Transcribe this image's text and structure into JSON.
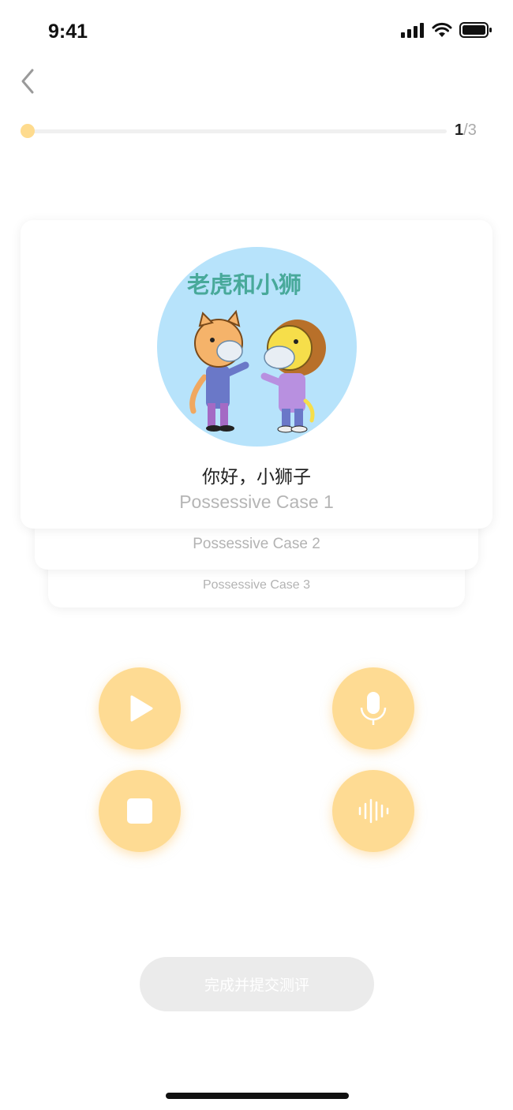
{
  "status_bar": {
    "time": "9:41"
  },
  "progress": {
    "current": "1",
    "separator": "/",
    "total": "3",
    "fraction": 0.0
  },
  "cards": [
    {
      "title": "你好，小狮子",
      "subtitle": "Possessive Case 1",
      "image_caption": "老虎和小狮"
    },
    {
      "subtitle": "Possessive Case 2"
    },
    {
      "subtitle": "Possessive Case 3"
    }
  ],
  "controls": {
    "play": "play-icon",
    "record": "microphone-icon",
    "stop": "stop-icon",
    "playback": "waveform-icon"
  },
  "submit_button": {
    "label": "完成并提交测评"
  },
  "colors": {
    "accent": "#fedb8e",
    "control_bg": "#fedb93",
    "disabled_button": "#ebebeb",
    "muted_text": "#b5b5b5"
  }
}
